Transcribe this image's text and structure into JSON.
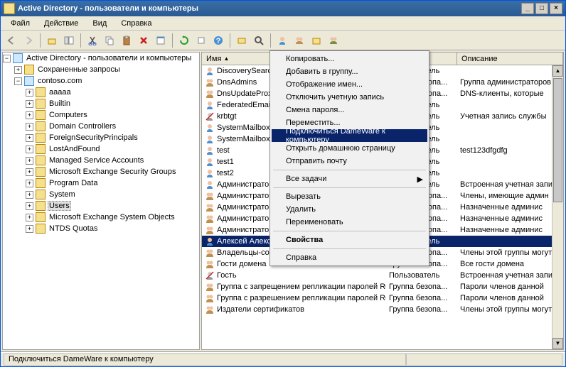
{
  "title": "Active Directory - пользователи и компьютеры",
  "winbuttons": {
    "min": "_",
    "max": "□",
    "close": "×"
  },
  "menu": [
    "Файл",
    "Действие",
    "Вид",
    "Справка"
  ],
  "tree": {
    "root": "Active Directory - пользователи и компьютеры",
    "saved": "Сохраненные запросы",
    "domain": "contoso.com",
    "nodes": [
      "aaaaa",
      "Builtin",
      "Computers",
      "Domain Controllers",
      "ForeignSecurityPrincipals",
      "LostAndFound",
      "Managed Service Accounts",
      "Microsoft Exchange Security Groups",
      "Program Data",
      "System",
      "Users",
      "Microsoft Exchange System Objects",
      "NTDS Quotas"
    ]
  },
  "columns": {
    "name": "Имя",
    "type": "Тип",
    "desc": "Описание"
  },
  "rows": [
    {
      "name": "DiscoverySearchMailbox",
      "type": "Пользователь",
      "desc": "",
      "icon": "user"
    },
    {
      "name": "DnsAdmins",
      "type": "Группа безопа...",
      "desc": "Группа администраторов",
      "icon": "group"
    },
    {
      "name": "DnsUpdateProxy",
      "type": "Группа безопа...",
      "desc": "DNS-клиенты, которые",
      "icon": "group"
    },
    {
      "name": "FederatedEmail.4…",
      "type": "Пользователь",
      "desc": "",
      "icon": "user"
    },
    {
      "name": "krbtgt",
      "type": "Пользователь",
      "desc": "Учетная запись службы",
      "icon": "userdis"
    },
    {
      "name": "SystemMailbox{1…",
      "type": "Пользователь",
      "desc": "",
      "icon": "user"
    },
    {
      "name": "SystemMailbox{e…",
      "type": "Пользователь",
      "desc": "",
      "icon": "user"
    },
    {
      "name": "test",
      "type": "Пользователь",
      "desc": "test123dfgdfg",
      "icon": "user"
    },
    {
      "name": "test1",
      "type": "Пользователь",
      "desc": "",
      "icon": "user"
    },
    {
      "name": "test2",
      "type": "Пользователь",
      "desc": "",
      "icon": "user"
    },
    {
      "name": "Администратор",
      "type": "Пользователь",
      "desc": "Встроенная учетная запись",
      "icon": "user"
    },
    {
      "name": "Администраторы …",
      "type": "Группа безопа...",
      "desc": "Члены, имеющие админ",
      "icon": "group"
    },
    {
      "name": "Администраторы …",
      "type": "Группа безопа...",
      "desc": "Назначенные админис",
      "icon": "group"
    },
    {
      "name": "Администраторы …",
      "type": "Группа безопа...",
      "desc": "Назначенные админис",
      "icon": "group"
    },
    {
      "name": "Администраторы …",
      "type": "Группа безопа...",
      "desc": "Назначенные админис",
      "icon": "group"
    },
    {
      "name": "Алексей Алексеев",
      "type": "Пользователь",
      "desc": "",
      "icon": "user",
      "selected": true
    },
    {
      "name": "Владельцы-создатели групповой политики",
      "type": "Группа безопа...",
      "desc": "Члены этой группы могут",
      "icon": "group"
    },
    {
      "name": "Гости домена",
      "type": "Группа безопа...",
      "desc": "Все гости домена",
      "icon": "group"
    },
    {
      "name": "Гость",
      "type": "Пользователь",
      "desc": "Встроенная учетная запись",
      "icon": "userdis"
    },
    {
      "name": "Группа с запрещением репликации паролей RODC",
      "type": "Группа безопа...",
      "desc": "Пароли членов данной",
      "icon": "group"
    },
    {
      "name": "Группа с разрешением репликации паролей RODC",
      "type": "Группа безопа...",
      "desc": "Пароли членов данной",
      "icon": "group"
    },
    {
      "name": "Издатели сертификатов",
      "type": "Группа безопа...",
      "desc": "Члены этой группы могут",
      "icon": "group"
    }
  ],
  "context": [
    {
      "label": "Копировать...",
      "type": "item"
    },
    {
      "label": "Добавить в группу...",
      "type": "item"
    },
    {
      "label": "Отображение имен...",
      "type": "item"
    },
    {
      "label": "Отключить учетную запись",
      "type": "item"
    },
    {
      "label": "Смена пароля...",
      "type": "item"
    },
    {
      "label": "Переместить...",
      "type": "item"
    },
    {
      "label": "Подключиться DameWare к компьютеру",
      "type": "item",
      "hl": true
    },
    {
      "label": "Открыть домашнюю страницу",
      "type": "item"
    },
    {
      "label": "Отправить почту",
      "type": "item"
    },
    {
      "type": "sep"
    },
    {
      "label": "Все задачи",
      "type": "item",
      "sub": true
    },
    {
      "type": "sep"
    },
    {
      "label": "Вырезать",
      "type": "item"
    },
    {
      "label": "Удалить",
      "type": "item"
    },
    {
      "label": "Переименовать",
      "type": "item"
    },
    {
      "type": "sep"
    },
    {
      "label": "Свойства",
      "type": "item",
      "bold": true
    },
    {
      "type": "sep"
    },
    {
      "label": "Справка",
      "type": "item"
    }
  ],
  "status": "Подключиться DameWare к компьютеру",
  "sort_indicator": "▲"
}
